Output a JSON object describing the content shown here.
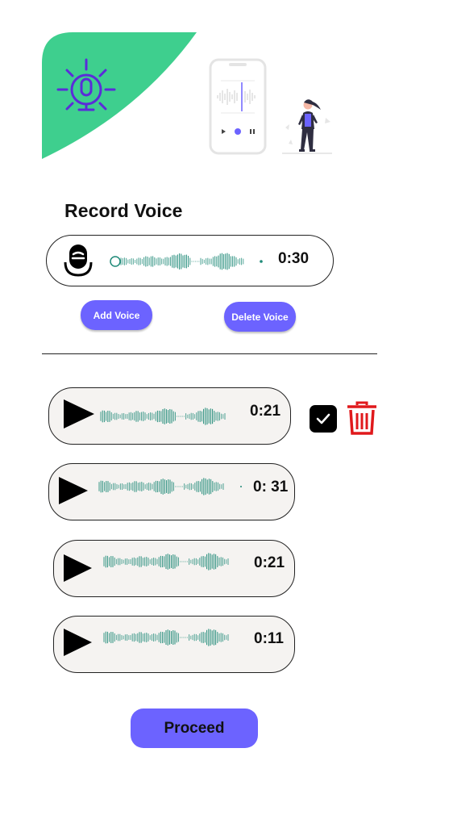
{
  "colors": {
    "accent": "#6c63ff",
    "hero_green": "#3ecf8e",
    "wave": "#1f8a78",
    "delete_red": "#e0191c",
    "card_bg": "#f5f3f1"
  },
  "header": {
    "title": "Record Voice"
  },
  "recorder": {
    "duration": "0:30",
    "icon": "microphone-icon"
  },
  "actions": {
    "add_label": "Add Voice",
    "delete_label": "Delete Voice"
  },
  "recordings": [
    {
      "duration": "0:21",
      "selected": true
    },
    {
      "duration": "0: 31"
    },
    {
      "duration": "0:21"
    },
    {
      "duration": "0:11"
    }
  ],
  "footer": {
    "proceed_label": "Proceed"
  }
}
